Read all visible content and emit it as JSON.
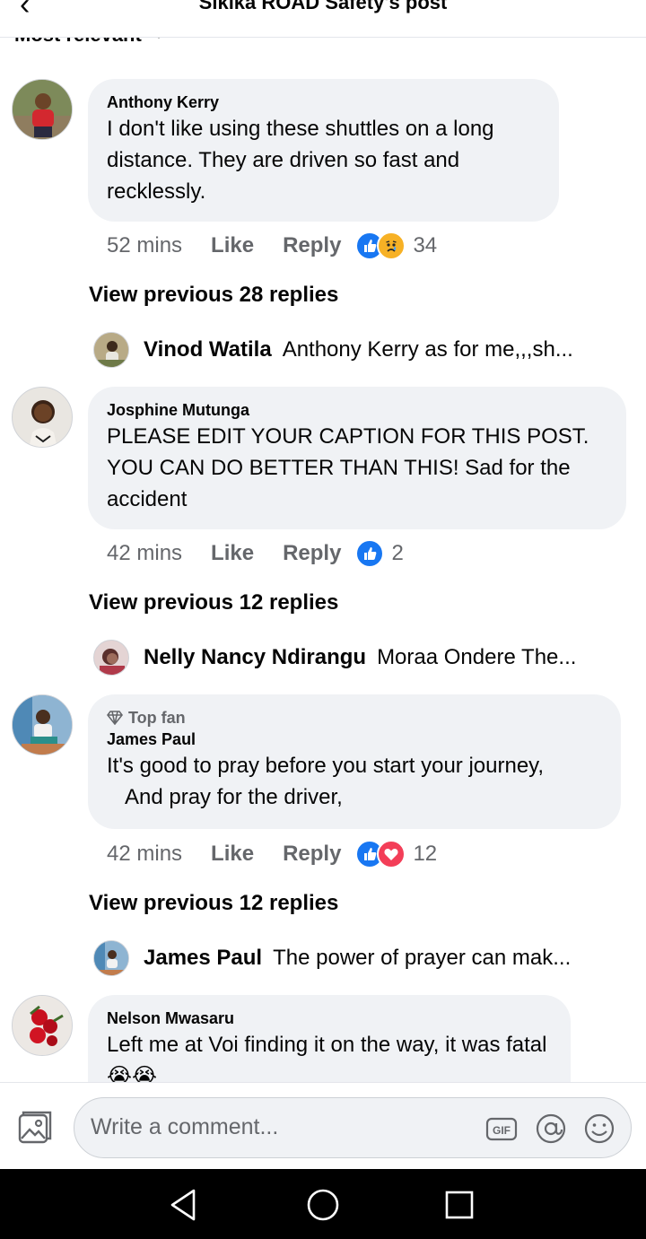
{
  "header": {
    "title": "Sikika ROAD Safety's post",
    "back_icon": "back-arrow-icon"
  },
  "sort": {
    "label": "Most relevant",
    "icon": "chevron-down-icon"
  },
  "comments": [
    {
      "name": "Anthony Kerry",
      "text": "I don't like using these shuttles on a long distance. They are driven so fast and recklessly.",
      "time": "52 mins",
      "like": "Like",
      "reply": "Reply",
      "reactions": [
        "like",
        "sad"
      ],
      "count": "34",
      "view_previous": "View previous 28 replies",
      "preview_name": "Vinod Watila",
      "preview_text": "Anthony Kerry as for me,,,sh..."
    },
    {
      "name": "Josphine Mutunga",
      "text": "PLEASE EDIT YOUR CAPTION FOR THIS POST. YOU CAN DO BETTER THAN THIS! Sad for the accident",
      "time": "42 mins",
      "like": "Like",
      "reply": "Reply",
      "reactions": [
        "like"
      ],
      "count": "2",
      "view_previous": "View previous 12 replies",
      "preview_name": "Nelly Nancy Ndirangu",
      "preview_text": "Moraa Ondere The..."
    },
    {
      "badge": "Top fan",
      "name": "James Paul",
      "text_line1": "It's good to pray before you start your journey,",
      "text_line2": "And pray for the driver,",
      "time": "42 mins",
      "like": "Like",
      "reply": "Reply",
      "reactions": [
        "like",
        "love"
      ],
      "count": "12",
      "view_previous": "View previous 12 replies",
      "preview_name": "James Paul",
      "preview_text": "The power of prayer can mak..."
    },
    {
      "name": "Nelson Mwasaru",
      "text": "Left me at Voi finding it on the way, it was fatal😭😭"
    }
  ],
  "composer": {
    "placeholder": "Write a comment...",
    "icons": [
      "photo-icon",
      "gif-icon",
      "mention-icon",
      "emoji-icon"
    ]
  },
  "colors": {
    "like_blue": "#1877f2",
    "love_red": "#f33e58",
    "sad_yellow": "#f7b125",
    "bubble_bg": "#f0f2f5",
    "secondary_text": "#65676b"
  }
}
